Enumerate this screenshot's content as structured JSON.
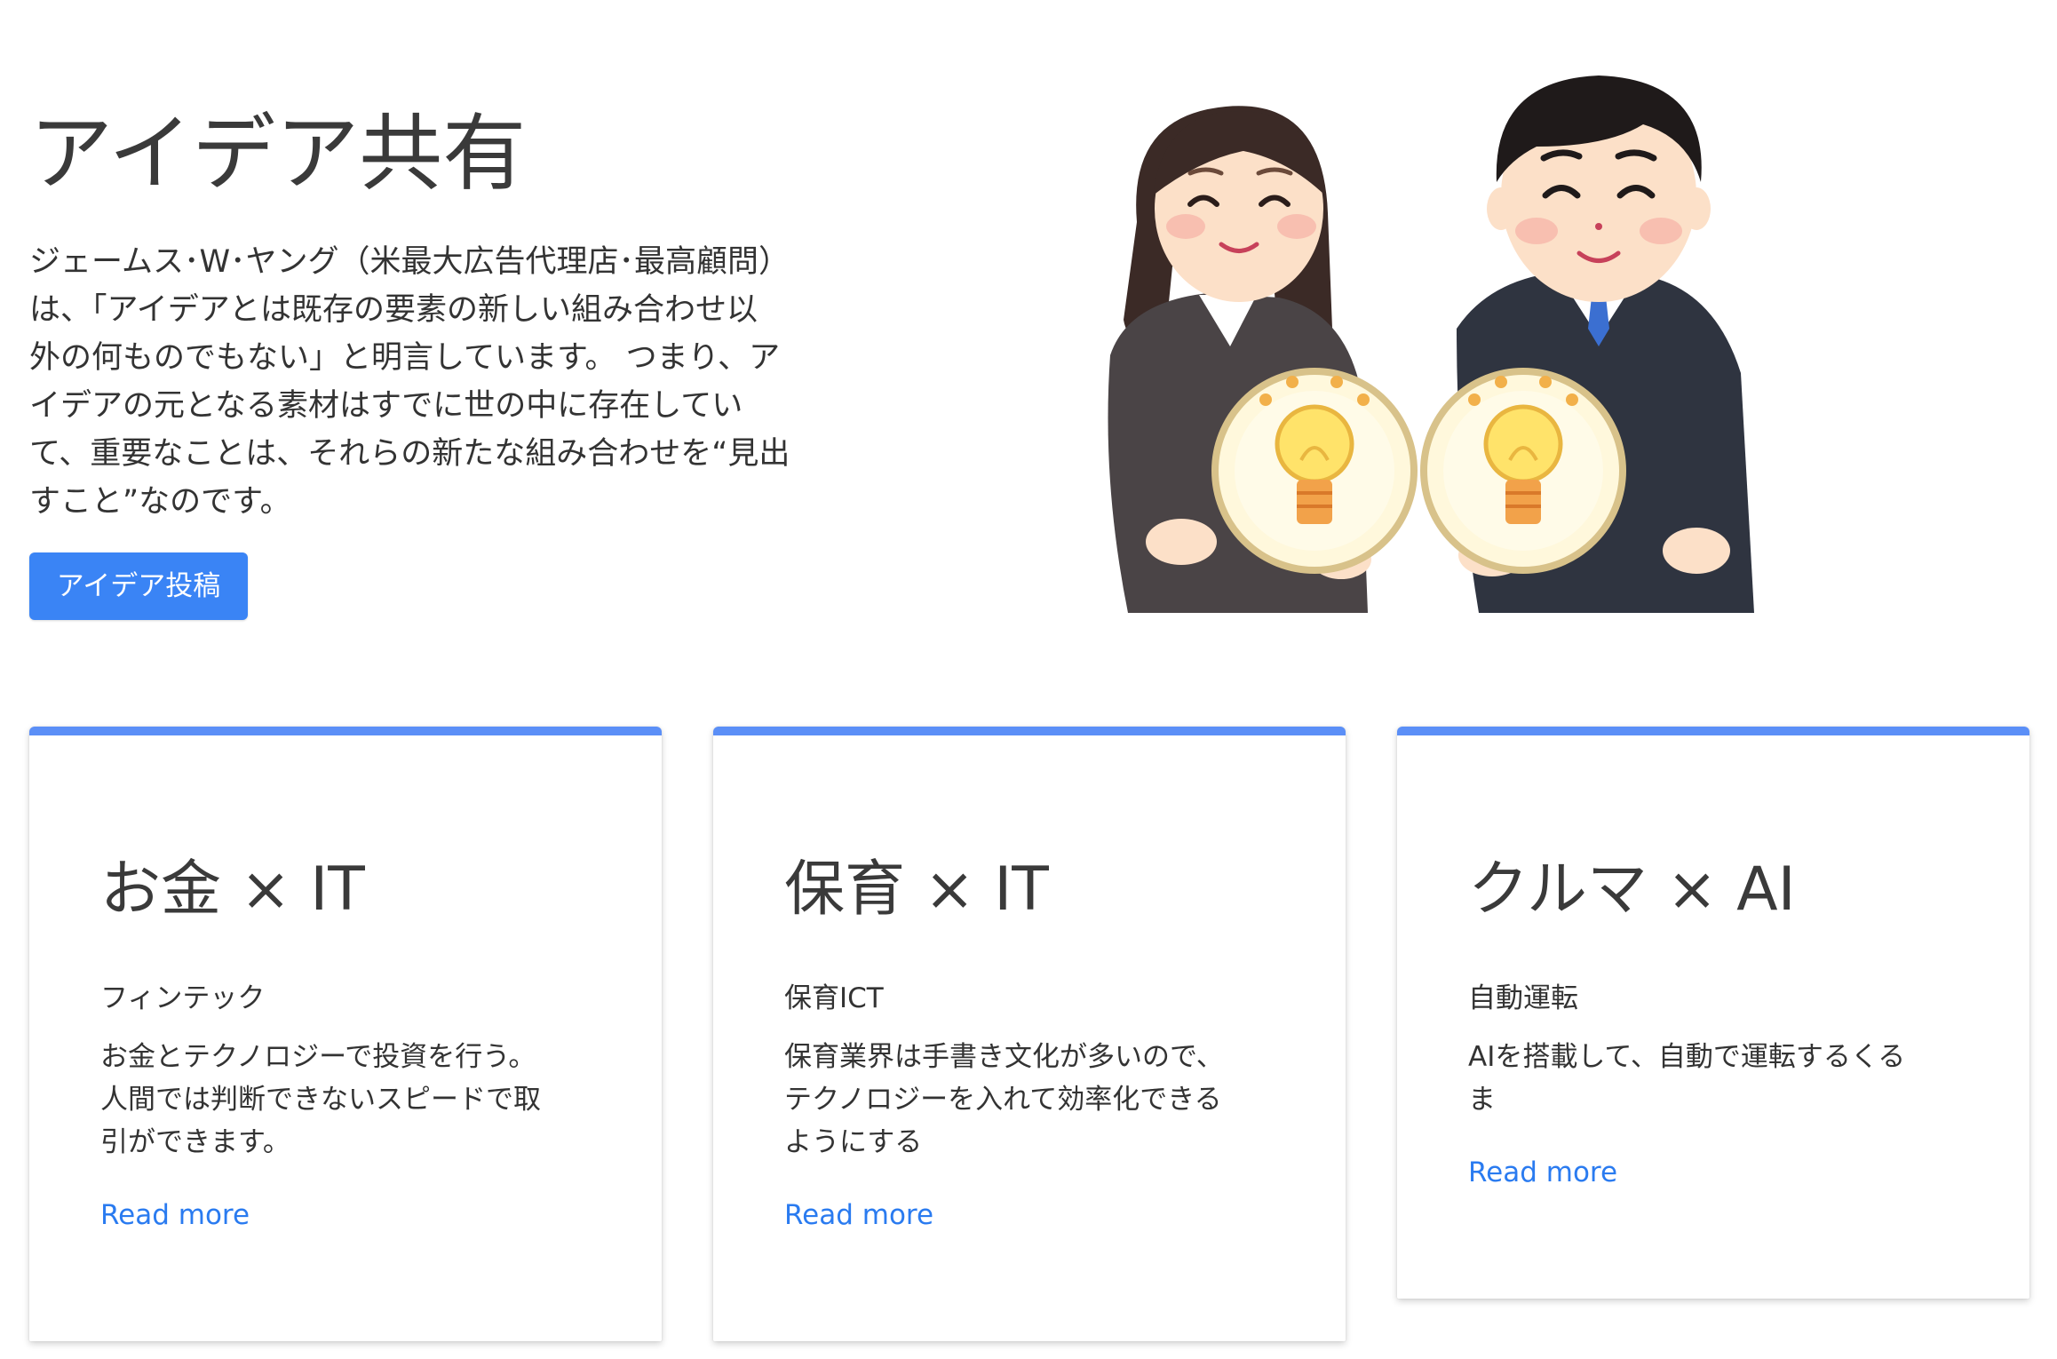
{
  "hero": {
    "title": "アイデア共有",
    "description_lines": [
      "ジェームス･W･ヤング（米最大広告代理店･最高顧問）",
      "は、「アイデアとは既存の要素の新しい組み合わせ以",
      "外の何ものでもない」と明言しています。 つまり、ア",
      "イデアの元となる素材はすでに世の中に存在してい",
      "て、重要なことは、それらの新たな組み合わせを“見出",
      "すこと”なのです。"
    ],
    "button_label": "アイデア投稿",
    "illustration": "two-business-people-holding-lightbulbs"
  },
  "cards": [
    {
      "title": "お金 × IT",
      "subtitle": "フィンテック",
      "text_lines": [
        "お金とテクノロジーで投資を行う。",
        "人間では判断できないスピードで取",
        "引ができます。"
      ],
      "link_label": "Read more"
    },
    {
      "title": "保育 × IT",
      "subtitle": "保育ICT",
      "text_lines": [
        "保育業界は手書き文化が多いので、",
        "テクノロジーを入れて効率化できる",
        "ようにする"
      ],
      "link_label": "Read more"
    },
    {
      "title": "クルマ × AI",
      "subtitle": "自動運転",
      "text_lines": [
        "AIを搭載して、自動で運転するくる",
        "ま"
      ],
      "link_label": "Read more"
    }
  ],
  "colors": {
    "primary_button": "#3a84f5",
    "card_accent": "#5b8ff7",
    "link": "#2a7bf0"
  }
}
